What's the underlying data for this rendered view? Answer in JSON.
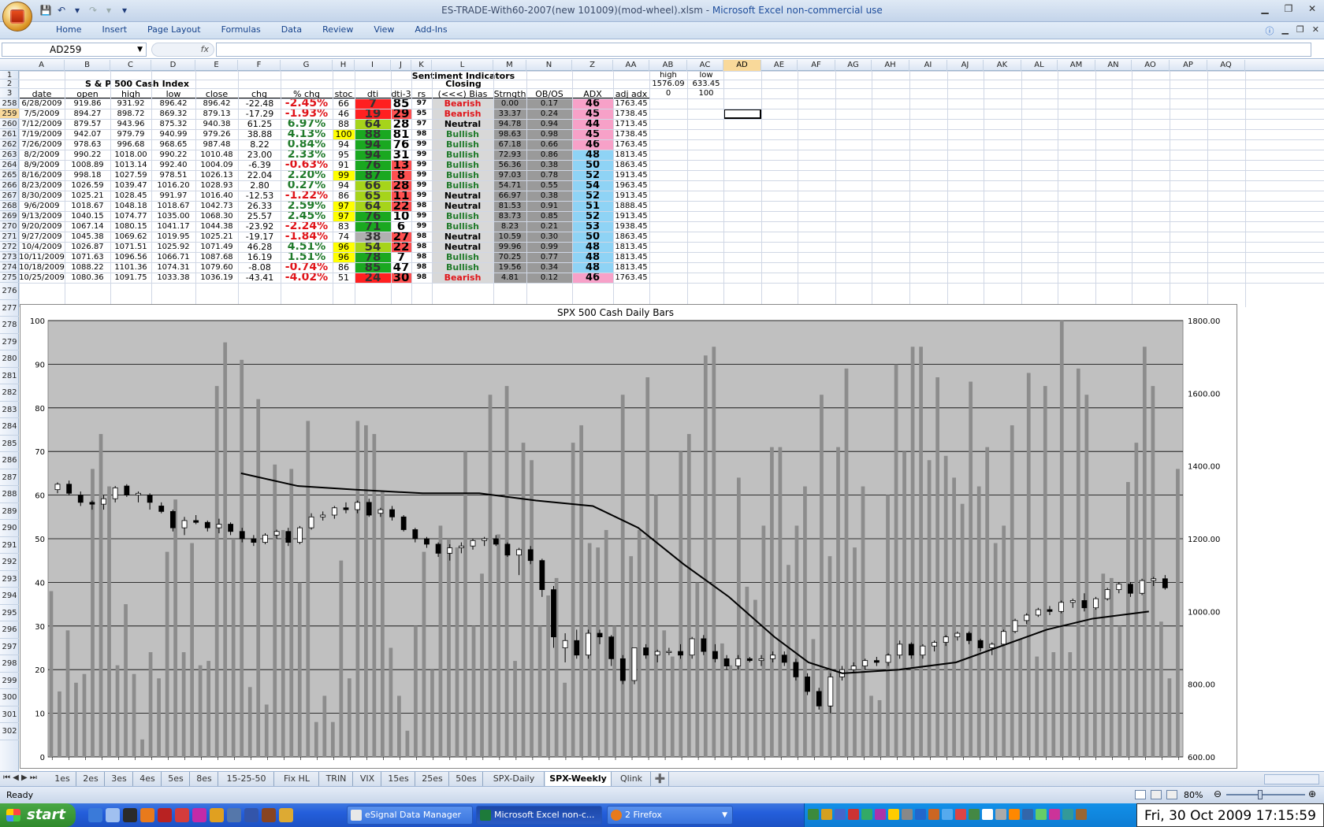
{
  "window": {
    "title_file": "ES-TRADE-With60-2007(new 101009)(mod-wheel).xlsm",
    "title_sep": " - ",
    "title_app": "Microsoft Excel non-commercial use"
  },
  "menu": [
    "Home",
    "Insert",
    "Page Layout",
    "Formulas",
    "Data",
    "Review",
    "View",
    "Add-Ins"
  ],
  "formula": {
    "namebox": "AD259",
    "fx": "fx",
    "value": ""
  },
  "columns": [
    "A",
    "B",
    "C",
    "D",
    "E",
    "F",
    "G",
    "H",
    "I",
    "J",
    "K",
    "L",
    "M",
    "N",
    "Z",
    "AA",
    "AB",
    "AC",
    "AD",
    "AE",
    "AF",
    "AG",
    "AH",
    "AI",
    "AJ",
    "AK",
    "AL",
    "AM",
    "AN",
    "AO",
    "AP",
    "AQ"
  ],
  "headers": {
    "index_title": "S & P 500 Cash Index",
    "sentiment_title": "Sentiment Indicators",
    "closing": "Closing",
    "col_labels": [
      "date",
      "open",
      "high",
      "low",
      "close",
      "chg",
      "% chg",
      "stoc",
      "dti",
      "dti-3",
      "rs",
      "(<<<) Bias",
      "Strngth",
      "OB/OS",
      "ADX",
      "adj adx"
    ],
    "ab_high_label": "high",
    "ab_high_value": "1576.09",
    "ab_high_zero": "0",
    "ac_low_label": "low",
    "ac_low_value": "633.45",
    "ac_low_hundred": "100"
  },
  "row_numbers": [
    "1",
    "2",
    "3",
    "258",
    "259",
    "260",
    "261",
    "262",
    "263",
    "264",
    "265",
    "266",
    "267",
    "268",
    "269",
    "270",
    "271",
    "272",
    "273",
    "274",
    "275",
    "276",
    "277",
    "278",
    "279",
    "280",
    "281",
    "282",
    "283",
    "284",
    "285",
    "286",
    "287",
    "288",
    "289",
    "290",
    "291",
    "292",
    "293",
    "294",
    "295",
    "296",
    "297",
    "298",
    "299",
    "300",
    "301",
    "302"
  ],
  "rows": [
    {
      "date": "6/28/2009",
      "open": "919.86",
      "high": "931.92",
      "low": "896.42",
      "close": "896.42",
      "chg": "-22.48",
      "pct": "-2.45%",
      "stoc": "66",
      "dti": "7",
      "dti3": "85",
      "rs": "97",
      "bias": "Bearish",
      "str": "0.00",
      "obos": "0.17",
      "adx": "46",
      "adj": "1763.45"
    },
    {
      "date": "7/5/2009",
      "open": "894.27",
      "high": "898.72",
      "low": "869.32",
      "close": "879.13",
      "chg": "-17.29",
      "pct": "-1.93%",
      "stoc": "46",
      "dti": "19",
      "dti3": "29",
      "rs": "95",
      "bias": "Bearish",
      "str": "33.37",
      "obos": "0.24",
      "adx": "45",
      "adj": "1738.45"
    },
    {
      "date": "7/12/2009",
      "open": "879.57",
      "high": "943.96",
      "low": "875.32",
      "close": "940.38",
      "chg": "61.25",
      "pct": "6.97%",
      "stoc": "88",
      "dti": "64",
      "dti3": "28",
      "rs": "97",
      "bias": "Neutral",
      "str": "94.78",
      "obos": "0.94",
      "adx": "44",
      "adj": "1713.45"
    },
    {
      "date": "7/19/2009",
      "open": "942.07",
      "high": "979.79",
      "low": "940.99",
      "close": "979.26",
      "chg": "38.88",
      "pct": "4.13%",
      "stoc": "100",
      "dti": "88",
      "dti3": "81",
      "rs": "98",
      "bias": "Bullish",
      "str": "98.63",
      "obos": "0.98",
      "adx": "45",
      "adj": "1738.45"
    },
    {
      "date": "7/26/2009",
      "open": "978.63",
      "high": "996.68",
      "low": "968.65",
      "close": "987.48",
      "chg": "8.22",
      "pct": "0.84%",
      "stoc": "94",
      "dti": "94",
      "dti3": "76",
      "rs": "99",
      "bias": "Bullish",
      "str": "67.18",
      "obos": "0.66",
      "adx": "46",
      "adj": "1763.45"
    },
    {
      "date": "8/2/2009",
      "open": "990.22",
      "high": "1018.00",
      "low": "990.22",
      "close": "1010.48",
      "chg": "23.00",
      "pct": "2.33%",
      "stoc": "95",
      "dti": "94",
      "dti3": "31",
      "rs": "99",
      "bias": "Bullish",
      "str": "72.93",
      "obos": "0.86",
      "adx": "48",
      "adj": "1813.45"
    },
    {
      "date": "8/9/2009",
      "open": "1008.89",
      "high": "1013.14",
      "low": "992.40",
      "close": "1004.09",
      "chg": "-6.39",
      "pct": "-0.63%",
      "stoc": "91",
      "dti": "76",
      "dti3": "13",
      "rs": "99",
      "bias": "Bullish",
      "str": "56.36",
      "obos": "0.38",
      "adx": "50",
      "adj": "1863.45"
    },
    {
      "date": "8/16/2009",
      "open": "998.18",
      "high": "1027.59",
      "low": "978.51",
      "close": "1026.13",
      "chg": "22.04",
      "pct": "2.20%",
      "stoc": "99",
      "dti": "87",
      "dti3": "8",
      "rs": "99",
      "bias": "Bullish",
      "str": "97.03",
      "obos": "0.78",
      "adx": "52",
      "adj": "1913.45"
    },
    {
      "date": "8/23/2009",
      "open": "1026.59",
      "high": "1039.47",
      "low": "1016.20",
      "close": "1028.93",
      "chg": "2.80",
      "pct": "0.27%",
      "stoc": "94",
      "dti": "66",
      "dti3": "28",
      "rs": "99",
      "bias": "Bullish",
      "str": "54.71",
      "obos": "0.55",
      "adx": "54",
      "adj": "1963.45"
    },
    {
      "date": "8/30/2009",
      "open": "1025.21",
      "high": "1028.45",
      "low": "991.97",
      "close": "1016.40",
      "chg": "-12.53",
      "pct": "-1.22%",
      "stoc": "86",
      "dti": "65",
      "dti3": "11",
      "rs": "99",
      "bias": "Neutral",
      "str": "66.97",
      "obos": "0.38",
      "adx": "52",
      "adj": "1913.45"
    },
    {
      "date": "9/6/2009",
      "open": "1018.67",
      "high": "1048.18",
      "low": "1018.67",
      "close": "1042.73",
      "chg": "26.33",
      "pct": "2.59%",
      "stoc": "97",
      "dti": "64",
      "dti3": "22",
      "rs": "98",
      "bias": "Neutral",
      "str": "81.53",
      "obos": "0.91",
      "adx": "51",
      "adj": "1888.45"
    },
    {
      "date": "9/13/2009",
      "open": "1040.15",
      "high": "1074.77",
      "low": "1035.00",
      "close": "1068.30",
      "chg": "25.57",
      "pct": "2.45%",
      "stoc": "97",
      "dti": "76",
      "dti3": "10",
      "rs": "99",
      "bias": "Bullish",
      "str": "83.73",
      "obos": "0.85",
      "adx": "52",
      "adj": "1913.45"
    },
    {
      "date": "9/20/2009",
      "open": "1067.14",
      "high": "1080.15",
      "low": "1041.17",
      "close": "1044.38",
      "chg": "-23.92",
      "pct": "-2.24%",
      "stoc": "83",
      "dti": "71",
      "dti3": "6",
      "rs": "99",
      "bias": "Bullish",
      "str": "8.23",
      "obos": "0.21",
      "adx": "53",
      "adj": "1938.45"
    },
    {
      "date": "9/27/2009",
      "open": "1045.38",
      "high": "1069.62",
      "low": "1019.95",
      "close": "1025.21",
      "chg": "-19.17",
      "pct": "-1.84%",
      "stoc": "74",
      "dti": "38",
      "dti3": "27",
      "rs": "98",
      "bias": "Neutral",
      "str": "10.59",
      "obos": "0.30",
      "adx": "50",
      "adj": "1863.45"
    },
    {
      "date": "10/4/2009",
      "open": "1026.87",
      "high": "1071.51",
      "low": "1025.92",
      "close": "1071.49",
      "chg": "46.28",
      "pct": "4.51%",
      "stoc": "96",
      "dti": "54",
      "dti3": "22",
      "rs": "98",
      "bias": "Neutral",
      "str": "99.96",
      "obos": "0.99",
      "adx": "48",
      "adj": "1813.45"
    },
    {
      "date": "10/11/2009",
      "open": "1071.63",
      "high": "1096.56",
      "low": "1066.71",
      "close": "1087.68",
      "chg": "16.19",
      "pct": "1.51%",
      "stoc": "96",
      "dti": "78",
      "dti3": "7",
      "rs": "98",
      "bias": "Bullish",
      "str": "70.25",
      "obos": "0.77",
      "adx": "48",
      "adj": "1813.45"
    },
    {
      "date": "10/18/2009",
      "open": "1088.22",
      "high": "1101.36",
      "low": "1074.31",
      "close": "1079.60",
      "chg": "-8.08",
      "pct": "-0.74%",
      "stoc": "86",
      "dti": "85",
      "dti3": "47",
      "rs": "98",
      "bias": "Bullish",
      "str": "19.56",
      "obos": "0.34",
      "adx": "48",
      "adj": "1813.45"
    },
    {
      "date": "10/25/2009",
      "open": "1080.36",
      "high": "1091.75",
      "low": "1033.38",
      "close": "1036.19",
      "chg": "-43.41",
      "pct": "-4.02%",
      "stoc": "51",
      "dti": "24",
      "dti3": "30",
      "rs": "98",
      "bias": "Bearish",
      "str": "4.81",
      "obos": "0.12",
      "adx": "46",
      "adj": "1763.45"
    }
  ],
  "colors": {
    "bullish": "#1f7a2a",
    "bearish": "#e0141a",
    "neutral": "#000000",
    "red_cell": "#ff2020",
    "green_cell": "#1aa820",
    "yellow_cell": "#ffff00",
    "adx_pink": "#f7a1c8",
    "adx_blue": "#8fd3f5",
    "plot_bg": "#c0c0c0",
    "selection": "#f9d99a"
  },
  "chart_data": {
    "type": "bar",
    "title": "SPX 500 Cash Daily Bars",
    "left_axis": {
      "min": 0,
      "max": 100,
      "ticks": [
        "0",
        "10",
        "20",
        "30",
        "40",
        "50",
        "60",
        "70",
        "80",
        "90",
        "100"
      ]
    },
    "right_axis": {
      "min": 600,
      "max": 1800,
      "ticks": [
        "600.00",
        "800.00",
        "1000.00",
        "1200.00",
        "1400.00",
        "1600.00",
        "1800.00"
      ]
    },
    "series": [
      {
        "kind": "volume-bars",
        "axis": "left",
        "values": [
          38,
          15,
          29,
          17,
          19,
          66,
          74,
          62,
          21,
          35,
          19,
          4,
          24,
          18,
          47,
          59,
          24,
          49,
          21,
          22,
          85,
          95,
          50,
          91,
          16,
          82,
          12,
          67,
          52,
          66,
          40,
          77,
          8,
          14,
          8,
          45,
          18,
          77,
          76,
          74,
          61,
          25,
          14,
          6,
          30,
          47,
          20,
          53,
          50,
          48,
          70,
          30,
          42,
          83,
          51,
          85,
          22,
          72,
          68,
          30,
          37,
          41,
          17,
          72,
          76,
          49,
          48,
          52,
          30,
          83,
          46,
          52,
          87,
          60,
          29,
          23,
          70,
          74,
          40,
          92,
          94,
          26,
          21,
          64,
          39,
          36,
          53,
          71,
          71,
          44,
          53,
          62,
          27,
          83,
          46,
          71,
          89,
          48,
          62,
          14,
          13,
          60,
          90,
          70,
          94,
          94,
          68,
          87,
          69,
          64,
          58,
          86,
          62,
          71,
          49,
          53,
          76,
          27,
          88,
          23,
          85,
          24,
          100,
          24,
          89,
          83,
          34,
          42,
          41,
          30,
          63,
          72,
          94,
          85,
          31,
          18,
          66
        ]
      },
      {
        "kind": "price-candles",
        "axis": "right",
        "note": "weekly OHLC candlesticks, approx 1000-1340 range left to 680-1090 right"
      },
      {
        "kind": "moving-average",
        "axis": "right",
        "note": "smooth black line from ~1380 declining to ~840 then rising to ~1000"
      }
    ]
  },
  "sheet_tabs": [
    "1es",
    "2es",
    "3es",
    "4es",
    "5es",
    "8es",
    "15-25-50",
    "Fix HL",
    "TRIN",
    "VIX",
    "15es",
    "25es",
    "50es",
    "SPX-Daily",
    "SPX-Weekly",
    "Qlink"
  ],
  "active_tab": "SPX-Weekly",
  "status": {
    "ready": "Ready",
    "zoom": "80%"
  },
  "taskbar": {
    "start": "start",
    "apps": [
      "eSignal Data Manager",
      "Microsoft Excel non-c...",
      "2 Firefox"
    ],
    "clock": "Fri, 30 Oct 2009   17:15:59"
  }
}
